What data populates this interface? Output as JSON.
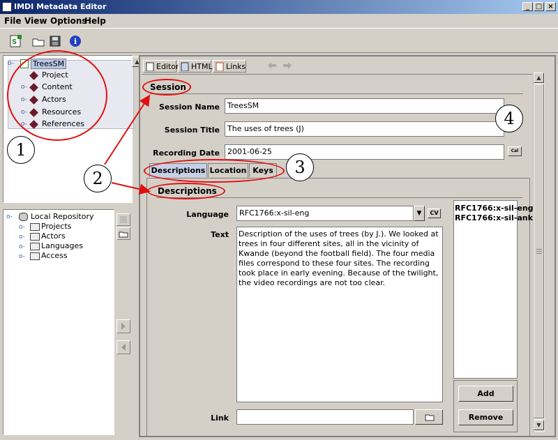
{
  "window": {
    "title": "IMDI Metadata Editor"
  },
  "menus": [
    {
      "label": "File"
    },
    {
      "label": "View"
    },
    {
      "label": "Options"
    },
    {
      "label": "Help"
    }
  ],
  "tree": {
    "root": "TreesSM",
    "children": [
      "Project",
      "Content",
      "Actors",
      "Resources",
      "References"
    ]
  },
  "repository": {
    "root": "Local Repository",
    "children": [
      "Projects",
      "Actors",
      "Languages",
      "Access"
    ]
  },
  "editor_tabs": [
    {
      "label": "Editor"
    },
    {
      "label": "HTML"
    },
    {
      "label": "Links"
    }
  ],
  "session": {
    "heading": "Session",
    "name_label": "Session Name",
    "name_value": "TreesSM",
    "title_label": "Session Title",
    "title_value": "The uses of trees (J)",
    "date_label": "Recording Date",
    "date_value": "2001-06-25",
    "cal_button": "Cal"
  },
  "inner_tabs": [
    {
      "label": "Descriptions"
    },
    {
      "label": "Location"
    },
    {
      "label": "Keys"
    }
  ],
  "descriptions": {
    "heading": "Descriptions",
    "language_label": "Language",
    "language_value": "RFC1766:x-sil-eng",
    "cv_button": "CV",
    "text_label": "Text",
    "text_value": "Description of the uses of trees (by J.).  We looked at trees in four different sites, all in the vicinity of Kwande (beyond the football field). The four media files correspond to these four sites.  The recording took place in early evening. Because of the twilight, the video recordings are not too clear.",
    "link_label": "Link",
    "lang_list": [
      "RFC1766:x-sil-eng",
      "RFC1766:x-sil-ank"
    ],
    "add_button": "Add",
    "remove_button": "Remove"
  },
  "annotations": [
    "1",
    "2",
    "3",
    "4"
  ]
}
